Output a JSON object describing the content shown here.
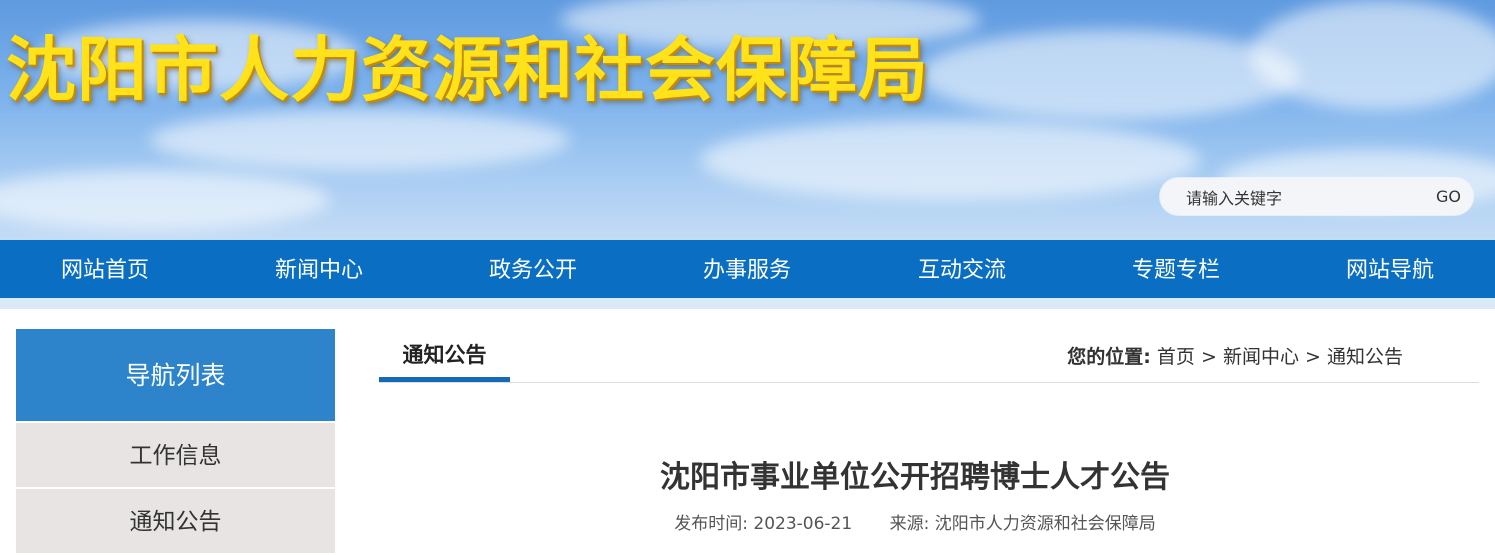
{
  "header": {
    "site_title": "沈阳市人力资源和社会保障局",
    "search_placeholder": "请输入关键字",
    "search_button": "GO"
  },
  "nav": {
    "items": [
      "网站首页",
      "新闻中心",
      "政务公开",
      "办事服务",
      "互动交流",
      "专题专栏",
      "网站导航"
    ]
  },
  "sidebar": {
    "heading": "导航列表",
    "items": [
      "工作信息",
      "通知公告"
    ]
  },
  "content": {
    "tab": "通知公告",
    "breadcrumb": {
      "label": "您的位置:",
      "items": [
        "首页",
        "新闻中心",
        "通知公告"
      ],
      "separator": ">"
    },
    "article": {
      "title": "沈阳市事业单位公开招聘博士人才公告",
      "publish_label": "发布时间:",
      "publish_date": "2023-06-21",
      "source_label": "来源:",
      "source": "沈阳市人力资源和社会保障局"
    }
  },
  "colors": {
    "nav": "#0a6fc3",
    "sidebar_head": "#2d84cb",
    "tab_underline": "#1569b5",
    "title": "#ffe21a"
  }
}
